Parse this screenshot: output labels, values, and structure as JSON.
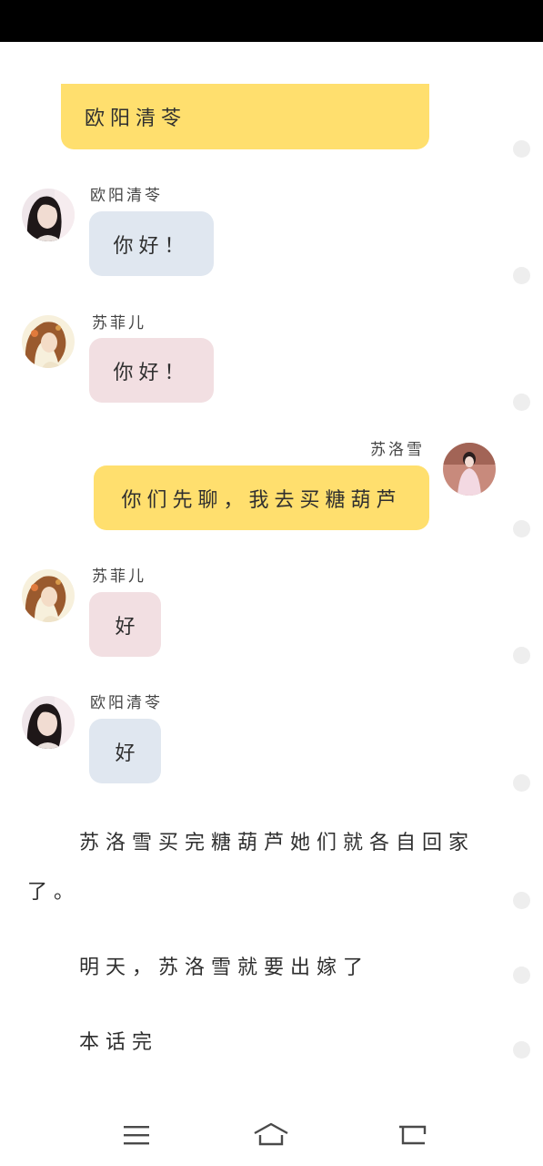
{
  "messages": [
    {
      "text": "欧阳清苓"
    },
    {
      "name": "欧阳清苓",
      "text": "你好！"
    },
    {
      "name": "苏菲儿",
      "text": "你好！"
    },
    {
      "name": "苏洛雪",
      "text": "你们先聊，我去买糖葫芦"
    },
    {
      "name": "苏菲儿",
      "text": "好"
    },
    {
      "name": "欧阳清苓",
      "text": "好"
    }
  ],
  "narration": {
    "line1a": "苏洛雪买完糖葫芦她们就各自回家",
    "line1b": "了。",
    "line2": "明天，苏洛雪就要出嫁了",
    "line3": "本话完"
  },
  "colors": {
    "self_bubble": "#ffdf6e",
    "ouyang_bubble": "#e0e7f0",
    "sufeier_bubble": "#f2dfe2"
  },
  "icons": {
    "menu": "menu-icon",
    "home": "home-icon",
    "back": "back-icon"
  }
}
